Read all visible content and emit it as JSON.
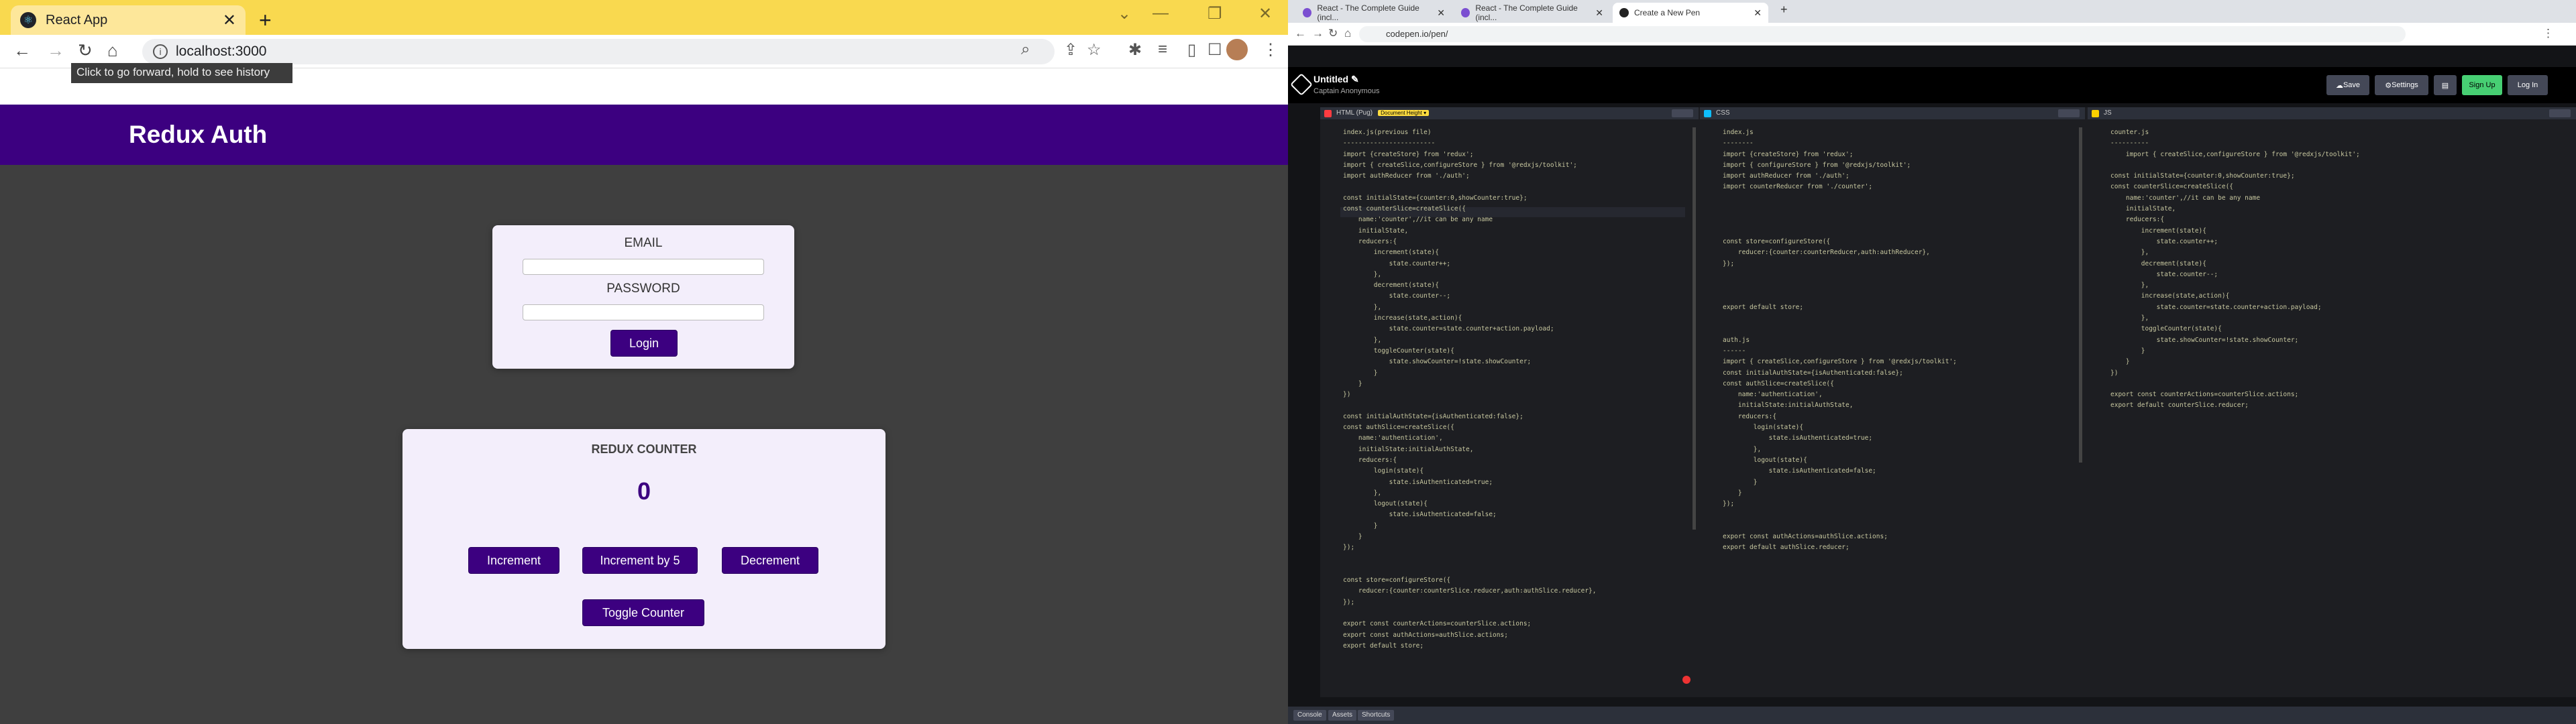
{
  "left_browser": {
    "tab_title": "React App",
    "address": "localhost:3000",
    "tooltip": "Click to go forward, hold to see history"
  },
  "app": {
    "title": "Redux Auth",
    "email_label": "EMAIL",
    "password_label": "PASSWORD",
    "login_label": "Login",
    "counter_title": "REDUX COUNTER",
    "counter_value": "0",
    "increment_label": "Increment",
    "increment5_label": "Increment by 5",
    "decrement_label": "Decrement",
    "toggle_label": "Toggle Counter"
  },
  "right_browser": {
    "tabs": [
      "React - The Complete Guide (incl...",
      "React - The Complete Guide (incl...",
      "Create a New Pen"
    ],
    "address": "codepen.io/pen/"
  },
  "codepen": {
    "title": "Untitled",
    "user": "Captain Anonymous",
    "save_label": "Save",
    "settings_label": "Settings",
    "signup_label": "Sign Up",
    "login_label": "Log In",
    "html_tab": "HTML (Pug)",
    "html_badge": "Document Height ▾",
    "css_tab": "CSS",
    "js_tab": "JS",
    "footer_buttons": [
      "Console",
      "Assets",
      "Shortcuts"
    ]
  },
  "code": {
    "html": [
      "index.js(previous file)",
      "------------------------",
      "import {createStore} from 'redux';",
      "import { createSlice,configureStore } from '@redxjs/toolkit';",
      "import authReducer from './auth';",
      "",
      "const initialState={counter:0,showCounter:true};",
      "const counterSlice=createSlice({",
      "    name:'counter',//it can be any name",
      "    initialState,",
      "    reducers:{",
      "        increment(state){",
      "            state.counter++;",
      "        },",
      "        decrement(state){",
      "            state.counter--;",
      "        },",
      "        increase(state,action){",
      "            state.counter=state.counter+action.payload;",
      "        },",
      "        toggleCounter(state){",
      "            state.showCounter=!state.showCounter;",
      "        }",
      "    }",
      "})",
      "",
      "const initialAuthState={isAuthenticated:false};",
      "const authSlice=createSlice({",
      "    name:'authentication',",
      "    initialState:initialAuthState,",
      "    reducers:{",
      "        login(state){",
      "            state.isAuthenticated=true;",
      "        },",
      "        logout(state){",
      "            state.isAuthenticated=false;",
      "        }",
      "    }",
      "});",
      "",
      "",
      "const store=configureStore({",
      "    reducer:{counter:counterSlice.reducer,auth:authSlice.reducer},",
      "});",
      "",
      "export const counterActions=counterSlice.actions;",
      "export const authActions=authSlice.actions;",
      "export default store;"
    ],
    "css": [
      "index.js",
      "--------",
      "import {createStore} from 'redux';",
      "import { configureStore } from '@redxjs/toolkit';",
      "import authReducer from './auth';",
      "import counterReducer from './counter';",
      "",
      "",
      "",
      "",
      "const store=configureStore({",
      "    reducer:{counter:counterReducer,auth:authReducer},",
      "});",
      "",
      "",
      "",
      "export default store;",
      "",
      "",
      "auth.js",
      "------",
      "import { createSlice,configureStore } from '@redxjs/toolkit';",
      "const initialAuthState={isAuthenticated:false};",
      "const authSlice=createSlice({",
      "    name:'authentication',",
      "    initialState:initialAuthState,",
      "    reducers:{",
      "        login(state){",
      "            state.isAuthenticated=true;",
      "        },",
      "        logout(state){",
      "            state.isAuthenticated=false;",
      "        }",
      "    }",
      "});",
      "",
      "",
      "export const authActions=authSlice.actions;",
      "export default authSlice.reducer;"
    ],
    "js": [
      "counter.js",
      "----------",
      "    import { createSlice,configureStore } from '@redxjs/toolkit';",
      "",
      "const initialState={counter:0,showCounter:true};",
      "const counterSlice=createSlice({",
      "    name:'counter',//it can be any name",
      "    initialState,",
      "    reducers:{",
      "        increment(state){",
      "            state.counter++;",
      "        },",
      "        decrement(state){",
      "            state.counter--;",
      "        },",
      "        increase(state,action){",
      "            state.counter=state.counter+action.payload;",
      "        },",
      "        toggleCounter(state){",
      "            state.showCounter=!state.showCounter;",
      "        }",
      "    }",
      "})",
      "",
      "export const counterActions=counterSlice.actions;",
      "export default counterSlice.reducer;"
    ]
  }
}
